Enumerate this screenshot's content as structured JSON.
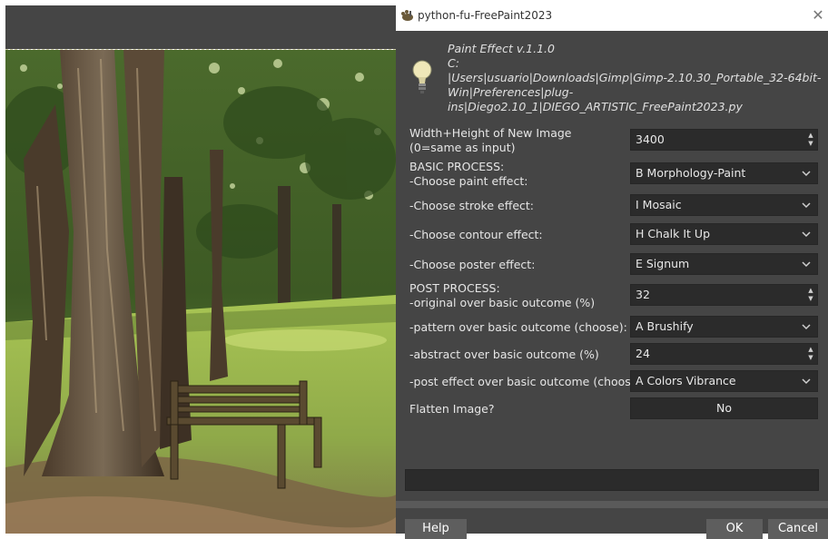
{
  "dialog": {
    "title": "python-fu-FreePaint2023",
    "info": {
      "name": "Paint Effect v.1.1.0",
      "path_lines": [
        "C:",
        "|Users|usuario|Downloads|Gimp|Gimp-2.10.30_Portable_32-64bit-",
        "Win|Preferences|plug-",
        "ins|Diego2.10_1|DIEGO_ARTISTIC_FreePaint2023.py"
      ]
    },
    "fields": {
      "size": {
        "label_1": "Width+Height of New Image",
        "label_2": "(0=same as input)",
        "value": "3400"
      },
      "paint": {
        "section": "BASIC PROCESS:",
        "label": "-Choose paint effect:",
        "value": "B Morphology-Paint"
      },
      "stroke": {
        "label": "-Choose stroke effect:",
        "value": "I Mosaic"
      },
      "contour": {
        "label": "-Choose contour effect:",
        "value": "H Chalk It Up"
      },
      "poster": {
        "label": "-Choose poster effect:",
        "value": "E Signum"
      },
      "original": {
        "section": "POST PROCESS:",
        "label": "-original over basic outcome (%)",
        "value": "32"
      },
      "pattern": {
        "label": "-pattern over basic outcome (choose):",
        "value": "A Brushify"
      },
      "abstract": {
        "label": "-abstract over basic outcome (%)",
        "value": "24"
      },
      "post_effect": {
        "label": "-post effect over basic outcome (choose)",
        "value": "A Colors Vibrance"
      },
      "flatten": {
        "label": "Flatten Image?",
        "value": "No"
      }
    },
    "buttons": {
      "help": "Help",
      "ok": "OK",
      "cancel": "Cancel"
    }
  },
  "icons": {
    "title": "gimp-wilber-icon",
    "info": "lightbulb-icon",
    "dropdown": "chevron-down-icon",
    "spinner": "spin-arrows-icon",
    "close": "close-icon"
  },
  "colors": {
    "dialog_bg": "#454545",
    "field_bg": "#2b2b2b",
    "text": "#e6e6e6"
  }
}
